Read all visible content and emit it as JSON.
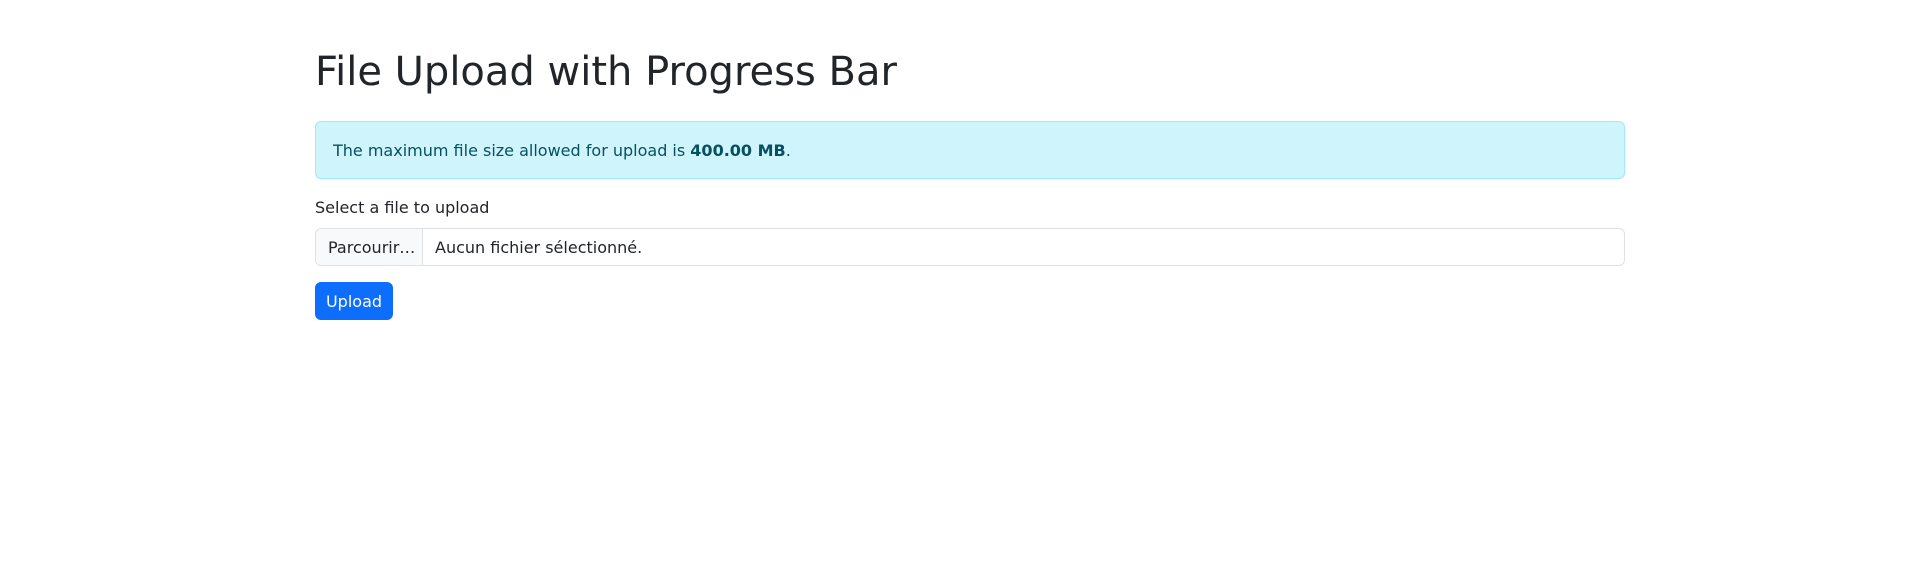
{
  "page": {
    "title": "File Upload with Progress Bar"
  },
  "alert": {
    "text_before": "The maximum file size allowed for upload is ",
    "max_size": "400.00 MB",
    "text_after": "."
  },
  "form": {
    "label": "Select a file to upload",
    "browse_label": "Parcourir…",
    "file_status": "Aucun fichier sélectionné.",
    "upload_label": "Upload"
  },
  "colors": {
    "primary": "#0d6efd",
    "alert_bg": "#cff4fc",
    "alert_text": "#055160"
  }
}
